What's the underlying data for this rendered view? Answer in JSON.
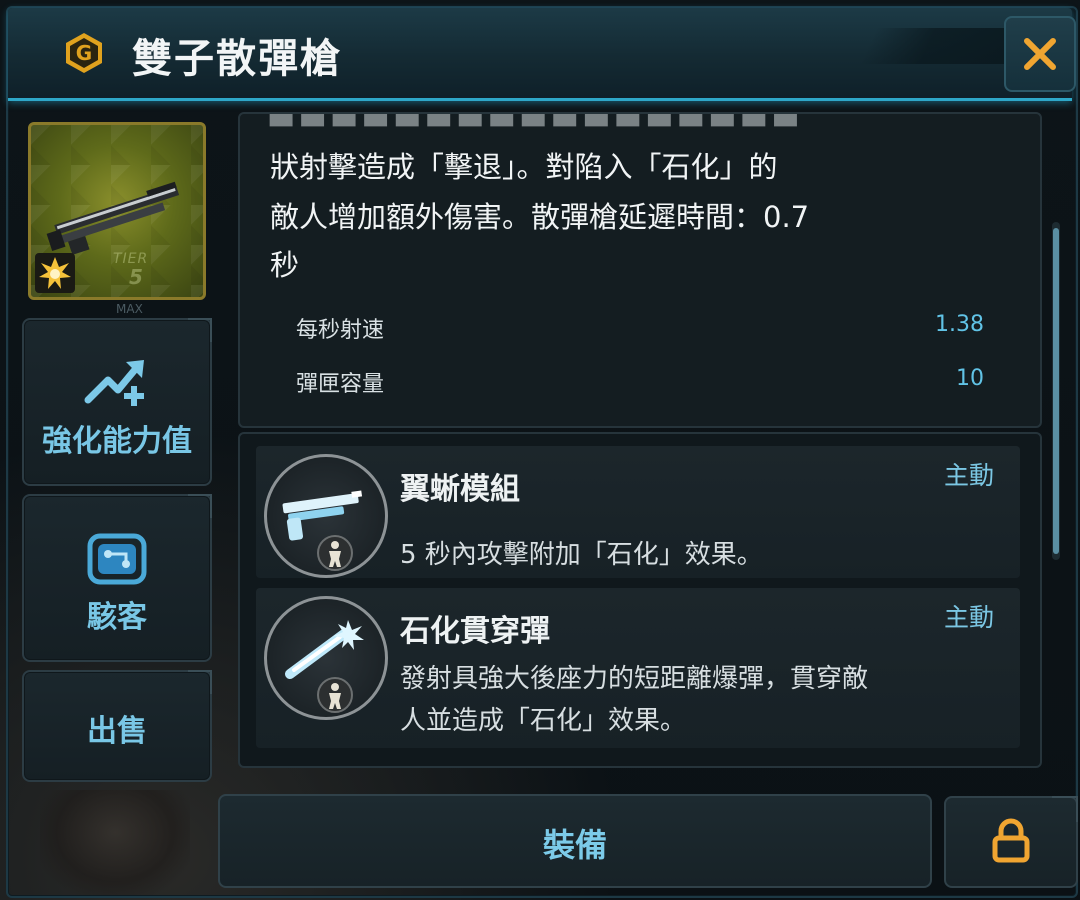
{
  "header": {
    "title": "雙子散彈槍",
    "grade_badge_letter": "G",
    "grade_badge_color": "#e0a21e",
    "close_icon": "close-x-icon",
    "close_icon_color": "#f0a531"
  },
  "weapon_thumb": {
    "tier_label": "TIER",
    "tier_number": "5",
    "max_label": "MAX",
    "element_icon": "explosion-burst-icon"
  },
  "side_menu": {
    "upgrade_label": "強化能力值",
    "upgrade_icon": "upgrade-arrow-plus-icon",
    "hacker_label": "駭客",
    "hacker_icon": "circuit-chip-icon",
    "sell_label": "出售"
  },
  "description": {
    "lines": [
      "狀射擊造成「擊退」。對陷入「石化」的",
      "敵人增加額外傷害。散彈槍延遲時間：0.7",
      "秒"
    ]
  },
  "stats": [
    {
      "label": "每秒射速",
      "value": "1.38"
    },
    {
      "label": "彈匣容量",
      "value": "10"
    }
  ],
  "mods": [
    {
      "name": "翼蜥模組",
      "type": "主動",
      "icon": "shotgun-mod-icon",
      "sub_icon": "figure-icon",
      "desc_lines": [
        "5 秒內攻擊附加「石化」效果。"
      ]
    },
    {
      "name": "石化貫穿彈",
      "type": "主動",
      "icon": "piercing-shot-icon",
      "sub_icon": "figure-icon",
      "desc_lines": [
        "發射具強大後座力的短距離爆彈，貫穿敵",
        "人並造成「石化」效果。"
      ]
    }
  ],
  "footer": {
    "equip_label": "裝備",
    "lock_icon": "lock-icon",
    "lock_color": "#f0a531"
  }
}
